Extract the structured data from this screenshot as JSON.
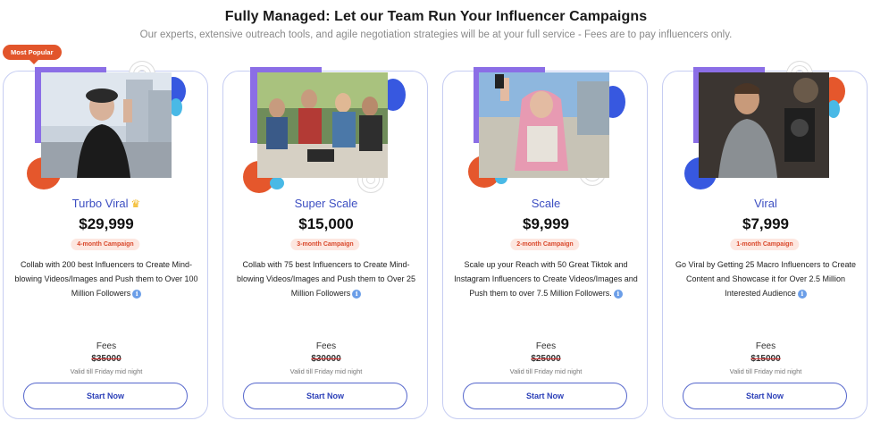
{
  "header": {
    "title": "Fully Managed: Let our Team Run Your Influencer Campaigns",
    "subtitle": "Our experts, extensive outreach tools, and agile negotiation strategies will be at your full service - Fees are to pay influencers only."
  },
  "badge_popular": "Most Popular",
  "info_glyph": "i",
  "crown_glyph": "♛",
  "cards": [
    {
      "plan": "Turbo Viral",
      "price": "$29,999",
      "duration": "4-month Campaign",
      "description": "Collab with 200 best Influencers to Create Mind-blowing Videos/Images and Push them to Over 100 Million Followers",
      "fees_label": "Fees",
      "fees_original": "$35000",
      "validity": "Valid till Friday mid night",
      "cta": "Start Now"
    },
    {
      "plan": "Super Scale",
      "price": "$15,000",
      "duration": "3-month Campaign",
      "description": "Collab with 75 best Influencers to Create Mind-blowing Videos/Images and Push them to Over 25 Million Followers",
      "fees_label": "Fees",
      "fees_original": "$30000",
      "validity": "Valid till Friday mid night",
      "cta": "Start Now"
    },
    {
      "plan": "Scale",
      "price": "$9,999",
      "duration": "2-month Campaign",
      "description": "Scale up your Reach with 50 Great Tiktok and Instagram Influencers to Create Videos/Images and Push them to over 7.5 Million Followers.",
      "fees_label": "Fees",
      "fees_original": "$25000",
      "validity": "Valid till Friday mid night",
      "cta": "Start Now"
    },
    {
      "plan": "Viral",
      "price": "$7,999",
      "duration": "1-month Campaign",
      "description": "Go Viral by Getting 25 Macro Influencers to Create Content and Showcase it for Over 2.5 Million Interested Audience",
      "fees_label": "Fees",
      "fees_original": "$15000",
      "validity": "Valid till Friday mid night",
      "cta": "Start Now"
    }
  ],
  "colors": {
    "accent_blue": "#3d4fc2",
    "purple": "#8b6ee6",
    "orange": "#e5572c",
    "royal_blue": "#3758e0",
    "cyan": "#49b9e6"
  }
}
